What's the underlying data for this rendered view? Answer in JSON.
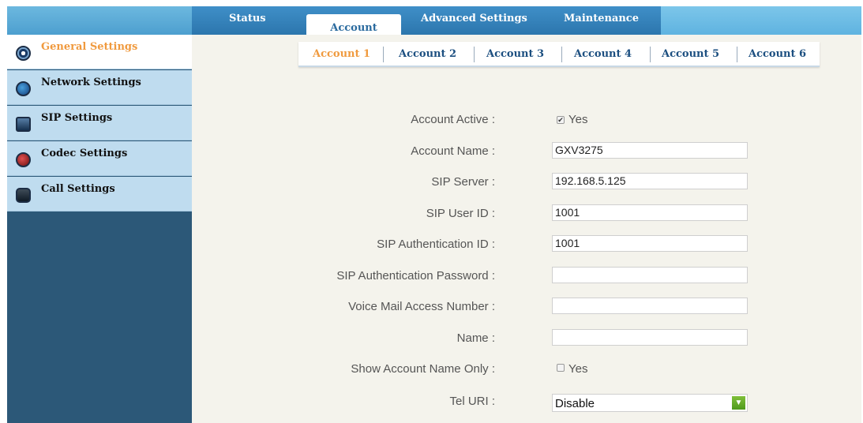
{
  "main_tabs": [
    {
      "label": "Status",
      "active": false
    },
    {
      "label": "Account",
      "active": true
    },
    {
      "label": "Advanced Settings",
      "active": false
    },
    {
      "label": "Maintenance",
      "active": false
    }
  ],
  "sidebar": {
    "items": [
      {
        "label": "General Settings",
        "icon": "gear-icon",
        "active": true
      },
      {
        "label": "Network Settings",
        "icon": "globe-icon",
        "active": false
      },
      {
        "label": "SIP Settings",
        "icon": "server-icon",
        "active": false
      },
      {
        "label": "Codec Settings",
        "icon": "codec-icon",
        "active": false
      },
      {
        "label": "Call Settings",
        "icon": "phone-icon",
        "active": false
      }
    ]
  },
  "sub_tabs": [
    {
      "label": "Account 1",
      "active": true
    },
    {
      "label": "Account 2",
      "active": false
    },
    {
      "label": "Account 3",
      "active": false
    },
    {
      "label": "Account 4",
      "active": false
    },
    {
      "label": "Account 5",
      "active": false
    },
    {
      "label": "Account 6",
      "active": false
    }
  ],
  "form": {
    "account_active": {
      "label": "Account Active :",
      "checked": true,
      "option": "Yes"
    },
    "account_name": {
      "label": "Account Name :",
      "value": "GXV3275"
    },
    "sip_server": {
      "label": "SIP Server :",
      "value": "192.168.5.125"
    },
    "sip_user_id": {
      "label": "SIP User ID :",
      "value": "1001"
    },
    "sip_auth_id": {
      "label": "SIP Authentication ID :",
      "value": "1001"
    },
    "sip_auth_password": {
      "label": "SIP Authentication Password :",
      "value": ""
    },
    "voice_mail": {
      "label": "Voice Mail Access Number :",
      "value": ""
    },
    "name": {
      "label": "Name :",
      "value": ""
    },
    "show_account_name": {
      "label": "Show Account Name Only :",
      "checked": false,
      "option": "Yes"
    },
    "tel_uri": {
      "label": "Tel URI :",
      "value": "Disable"
    }
  },
  "colors": {
    "accent_orange": "#f09a3e",
    "sidebar_dark": "#2c5878",
    "tab_blue": "#2c76ad",
    "content_bg": "#f4f3ec"
  }
}
